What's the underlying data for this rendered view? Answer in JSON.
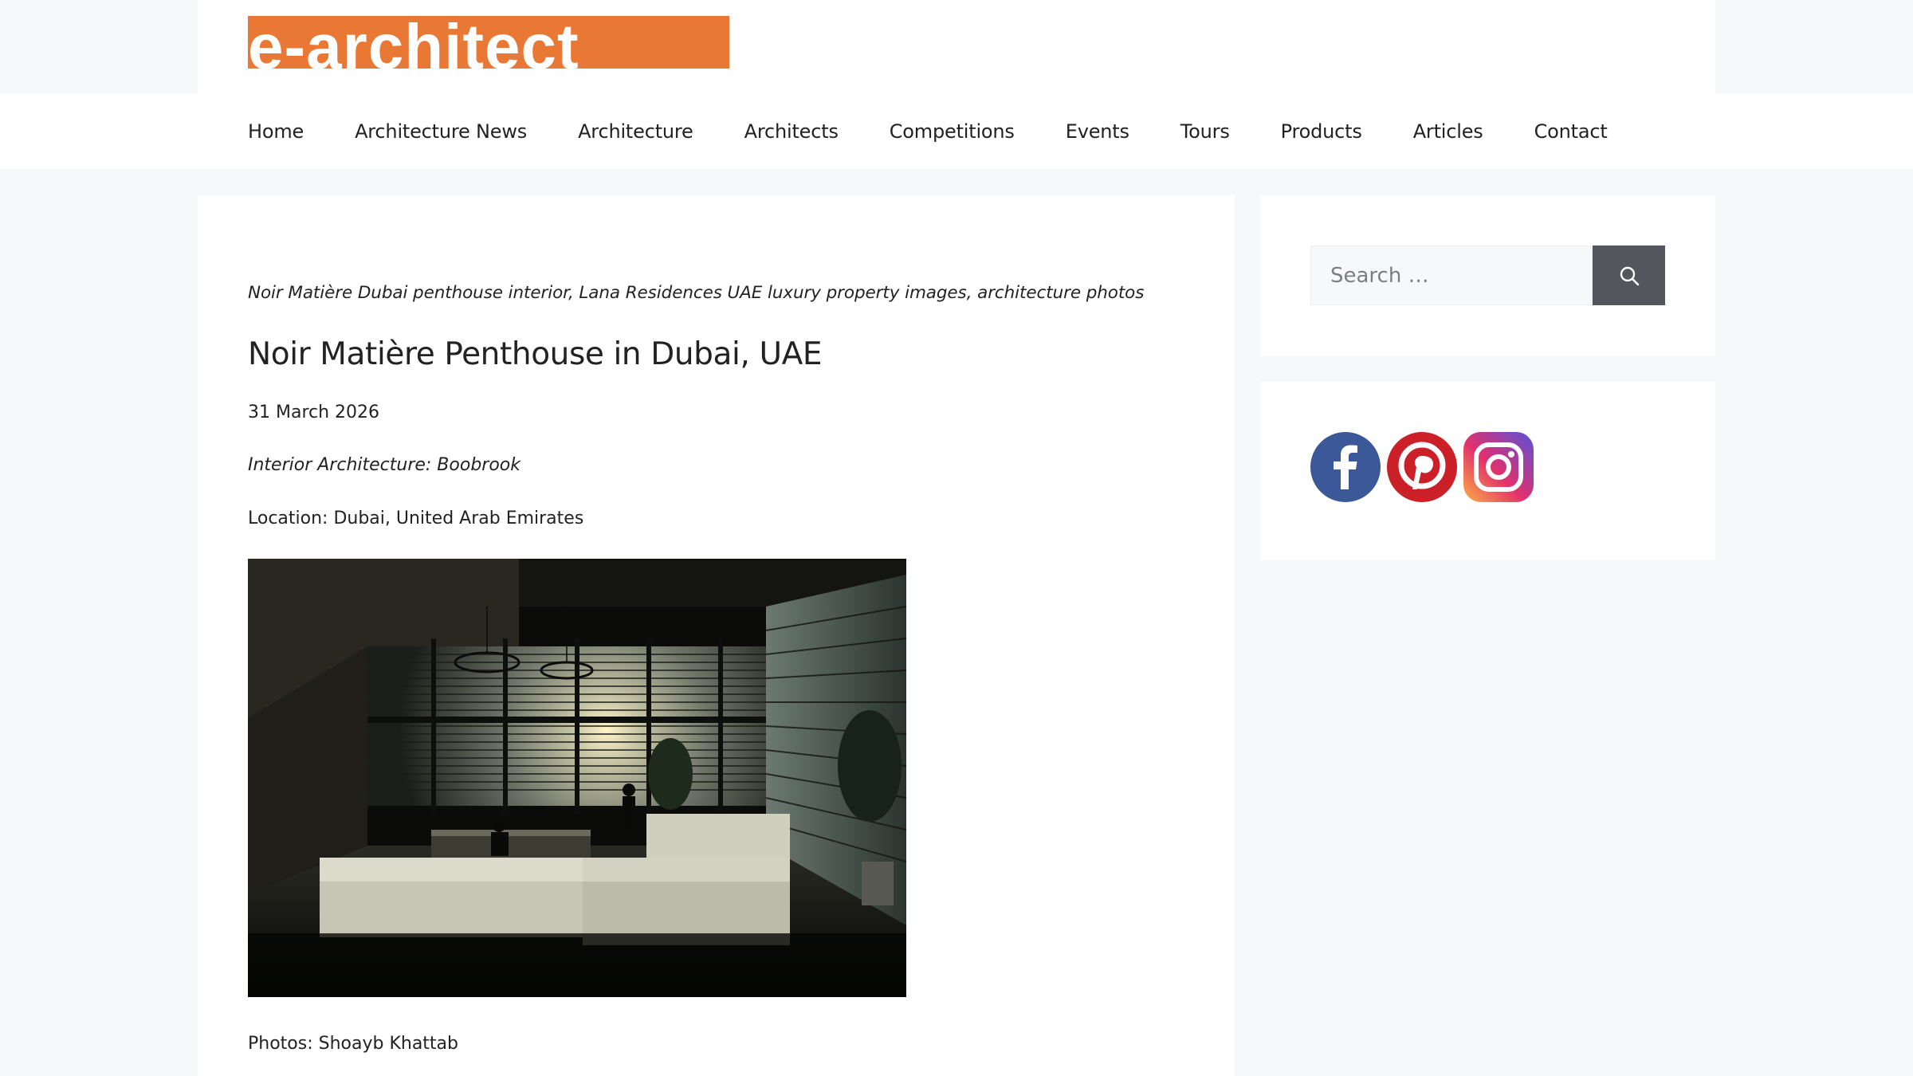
{
  "logo": {
    "text": "e-architect"
  },
  "nav": {
    "items": [
      "Home",
      "Architecture News",
      "Architecture",
      "Architects",
      "Competitions",
      "Events",
      "Tours",
      "Products",
      "Articles",
      "Contact"
    ]
  },
  "article": {
    "caption": "Noir Matière Dubai penthouse interior, Lana Residences UAE luxury property images, architecture photos",
    "title": "Noir Matière Penthouse in Dubai, UAE",
    "date": "31 March 2026",
    "designer": "Interior Architecture: Boobrook",
    "location": "Location: Dubai, United Arab Emirates",
    "credit": "Photos: Shoayb Khattab"
  },
  "search": {
    "placeholder": "Search …"
  },
  "social": {
    "icons": [
      "facebook-icon",
      "pinterest-icon",
      "instagram-icon"
    ]
  },
  "colors": {
    "logo_bg": "#ea7835",
    "page_bg": "#f7f8f9",
    "search_button": "#55555e",
    "facebook": "#3b5998",
    "pinterest": "#cb2027"
  }
}
